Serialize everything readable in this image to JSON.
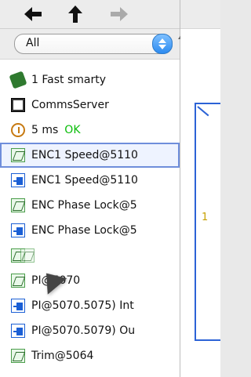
{
  "toolbar": {
    "back_icon": "arrow-left-icon",
    "up_icon": "arrow-up-icon",
    "forward_icon": "arrow-right-icon"
  },
  "filter": {
    "selected": "All"
  },
  "list": {
    "items": [
      {
        "label": "1 Fast smarty",
        "icon": "battery-icon"
      },
      {
        "label": "CommsServer",
        "icon": "comms-icon"
      },
      {
        "label": "5 ms",
        "status": "OK",
        "icon": "stopwatch-icon"
      },
      {
        "label": "ENC1 Speed@5110",
        "icon": "amplifier-icon",
        "selected": true
      },
      {
        "label": "ENC1 Speed@5110",
        "icon": "link-icon"
      },
      {
        "label": "ENC Phase Lock@5",
        "icon": "amplifier-icon"
      },
      {
        "label": "ENC Phase Lock@5",
        "icon": "link-icon"
      },
      {
        "label": "",
        "icon": "amplifier-icon"
      },
      {
        "label": "PI@5070",
        "icon": "amplifier-icon"
      },
      {
        "label": "PI@5070.5075) Int",
        "icon": "link-icon"
      },
      {
        "label": "PI@5070.5079) Ou",
        "icon": "link-icon"
      },
      {
        "label": "Trim@5064",
        "icon": "amplifier-icon"
      }
    ]
  },
  "canvas": {
    "label": "1"
  },
  "colors": {
    "selection_border": "#6f8edb",
    "ok_text": "#0bbd0b",
    "wire_blue": "#2c63d6"
  }
}
